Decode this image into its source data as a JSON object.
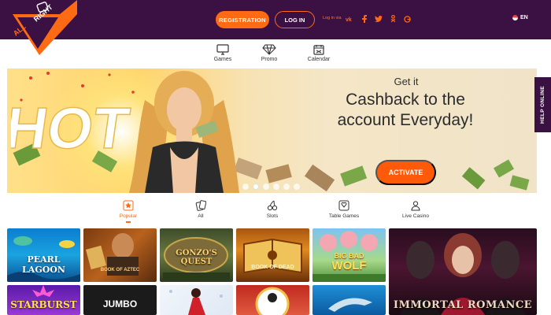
{
  "brand": {
    "logo_text": "ALL RIGHT"
  },
  "header": {
    "registration_label": "REGISTRATION",
    "login_label": "LOG IN",
    "login_via_label": "Log in via",
    "social_icons": [
      "vk-icon",
      "facebook-icon",
      "twitter-icon",
      "odnoklassniki-icon",
      "google-icon"
    ],
    "language": "EN"
  },
  "nav": {
    "items": [
      {
        "label": "Games",
        "icon": "monitor-icon"
      },
      {
        "label": "Promo",
        "icon": "diamond-icon"
      },
      {
        "label": "Calendar",
        "icon": "calendar-icon"
      }
    ]
  },
  "banner": {
    "hot_text": "HOT",
    "small_text": "Get it",
    "headline": "Cashback to the account Everyday!",
    "cta_label": "ACTIVATE",
    "slide_count": 6,
    "active_slide": 2
  },
  "help_tab": {
    "label": "HELP ONLINE"
  },
  "categories": {
    "items": [
      {
        "label": "Popular",
        "icon": "star-icon"
      },
      {
        "label": "All",
        "icon": "cards-icon"
      },
      {
        "label": "Slots",
        "icon": "cherry-icon"
      },
      {
        "label": "Table Games",
        "icon": "table-games-icon"
      },
      {
        "label": "Live Casino",
        "icon": "dealer-icon"
      }
    ],
    "active": "Popular"
  },
  "games": {
    "pearl_lagoon": "PEARL LAGOON",
    "book_of_aztec": "BOOK OF AZTEC",
    "gonzos_quest": "GONZO'S QUEST",
    "book_of_dead": "BOOK OF DEAD",
    "big_bad_wolf_top": "BIG BAD",
    "big_bad_wolf_bottom": "WOLF",
    "immortal_romance": "IMMORTAL ROMANCE",
    "starburst": "STARBURST",
    "jumbo": "JUMBO"
  },
  "colors": {
    "header_bg": "#3b1042",
    "accent": "#ff6a13",
    "cta": "#ff5a0a"
  }
}
